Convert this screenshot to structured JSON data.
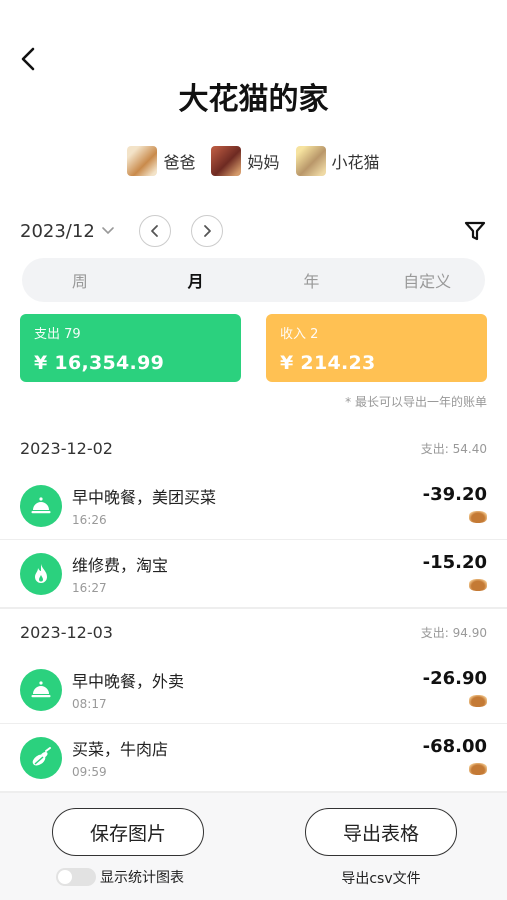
{
  "header": {
    "title": "大花猫的家"
  },
  "members": [
    {
      "name": "爸爸",
      "avatar_color": "#c98a4b"
    },
    {
      "name": "妈妈",
      "avatar_color": "#8b3a32"
    },
    {
      "name": "小花猫",
      "avatar_color": "#d9b56a"
    }
  ],
  "period": {
    "date": "2023/12"
  },
  "tabs": [
    {
      "label": "周",
      "active": false
    },
    {
      "label": "月",
      "active": true
    },
    {
      "label": "年",
      "active": false
    },
    {
      "label": "自定义",
      "active": false
    }
  ],
  "summary": {
    "expense_label": "支出 79",
    "expense_amount": "¥ 16,354.99",
    "income_label": "收入 2",
    "income_amount": "¥ 214.23",
    "expense_color": "#2bd17e",
    "income_color": "#ffc153"
  },
  "note": "* 最长可以导出一年的账单",
  "days": [
    {
      "date": "2023-12-02",
      "total": "支出: 54.40",
      "entries": [
        {
          "title": "早中晚餐，美团买菜",
          "time": "16:26",
          "amount": "-39.20",
          "icon": "meal-cloche-icon"
        },
        {
          "title": "维修费，淘宝",
          "time": "16:27",
          "amount": "-15.20",
          "icon": "flame-icon"
        }
      ]
    },
    {
      "date": "2023-12-03",
      "total": "支出: 94.90",
      "entries": [
        {
          "title": "早中晚餐，外卖",
          "time": "08:17",
          "amount": "-26.90",
          "icon": "meal-cloche-icon"
        },
        {
          "title": "买菜，牛肉店",
          "time": "09:59",
          "amount": "-68.00",
          "icon": "vegetable-icon"
        }
      ]
    }
  ],
  "footer": {
    "save_label": "保存图片",
    "export_label": "导出表格",
    "toggle_label": "显示统计图表",
    "toggle_on": false,
    "csv_label": "导出csv文件"
  }
}
